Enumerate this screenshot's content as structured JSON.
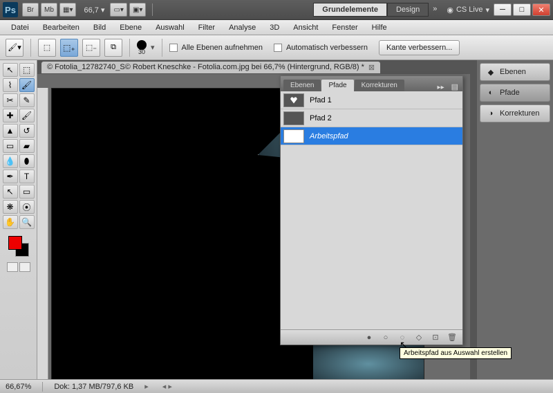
{
  "titlebar": {
    "zoom": "66,7",
    "workspace_active": "Grundelemente",
    "workspace_other": "Design",
    "cslive": "CS Live"
  },
  "menu": [
    "Datei",
    "Bearbeiten",
    "Bild",
    "Ebene",
    "Auswahl",
    "Filter",
    "Analyse",
    "3D",
    "Ansicht",
    "Fenster",
    "Hilfe"
  ],
  "options": {
    "brush_size": "30",
    "chk1": "Alle Ebenen aufnehmen",
    "chk2": "Automatisch verbessern",
    "refine_btn": "Kante verbessern..."
  },
  "document": {
    "tab": "© Fotolia_12782740_S© Robert Kneschke - Fotolia.com.jpg bei 66,7% (Hintergrund, RGB/8) *"
  },
  "rightpanel": {
    "ebenen": "Ebenen",
    "pfade": "Pfade",
    "korrekturen": "Korrekturen"
  },
  "paths_panel": {
    "tab_ebenen": "Ebenen",
    "tab_pfade": "Pfade",
    "tab_korrekturen": "Korrekturen",
    "items": [
      {
        "label": "Pfad 1"
      },
      {
        "label": "Pfad 2"
      },
      {
        "label": "Arbeitspfad"
      }
    ]
  },
  "tooltip": "Arbeitspfad aus Auswahl erstellen",
  "status": {
    "zoom": "66,67%",
    "doc": "Dok: 1,37 MB/797,6 KB"
  }
}
